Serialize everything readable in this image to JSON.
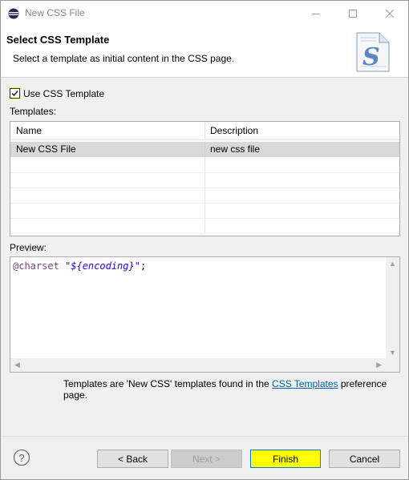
{
  "window": {
    "title": "New CSS File"
  },
  "header": {
    "title": "Select CSS Template",
    "description": "Select a template as initial content in the CSS page."
  },
  "use_template": {
    "label": "Use CSS Template",
    "checked": true
  },
  "templates": {
    "label": "Templates:",
    "columns": [
      "Name",
      "Description"
    ],
    "rows": [
      {
        "name": "New CSS File",
        "description": "new css file",
        "selected": true
      }
    ]
  },
  "preview": {
    "label": "Preview:",
    "code_keyword": "@charset",
    "code_string": "\"${encoding}\"",
    "code_end": ";"
  },
  "note": {
    "before": "Templates are 'New CSS' templates found in the ",
    "link": "CSS Templates",
    "after": " preference page."
  },
  "buttons": {
    "back": "< Back",
    "next": "Next >",
    "finish": "Finish",
    "cancel": "Cancel"
  },
  "colors": {
    "highlight": "#ffff00",
    "link": "#0063b1",
    "selected_row": "#d9d9d9"
  },
  "icons": [
    "eclipse-app-icon",
    "minimize-icon",
    "maximize-icon",
    "close-icon",
    "css-file-logo-icon",
    "checkmark-icon",
    "help-icon"
  ]
}
